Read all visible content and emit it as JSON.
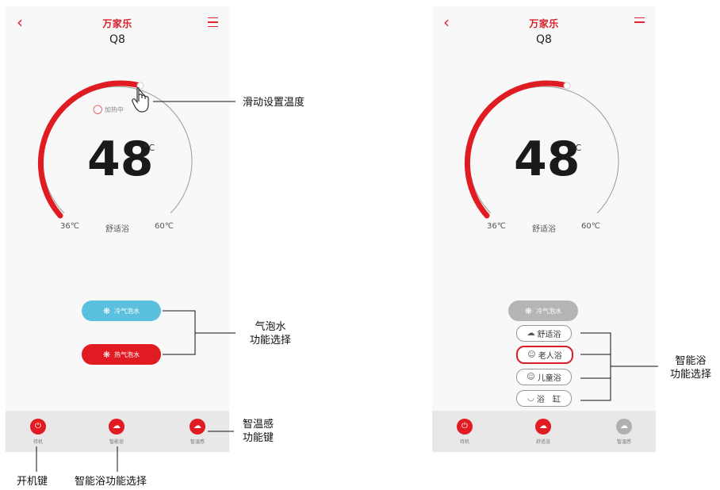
{
  "left_phone": {
    "back_icon": "back-chevron-icon",
    "menu_icon": "hamburger-menu-icon",
    "brand": "万家乐",
    "model": "Q8",
    "status_text": "加热中",
    "temperature": "48",
    "unit": "°C",
    "min_label": "36℃",
    "mode_label": "舒适浴",
    "max_label": "60℃",
    "bubble_cold_label": "冷气泡水",
    "bubble_hot_label": "热气泡水",
    "footer": [
      {
        "icon": "power-icon",
        "label": "待机"
      },
      {
        "icon": "cloud-icon",
        "label": "智能浴"
      },
      {
        "icon": "cloud-icon",
        "label": "智温感"
      }
    ]
  },
  "right_phone": {
    "brand": "万家乐",
    "model": "Q8",
    "temperature": "48",
    "unit": "°C",
    "min_label": "36℃",
    "mode_label": "舒适浴",
    "max_label": "60℃",
    "bubble_label": "冷气泡水",
    "modes": [
      {
        "icon": "cloud-icon",
        "label": "舒适浴",
        "active": false
      },
      {
        "icon": "smile-icon",
        "label": "老人浴",
        "active": true
      },
      {
        "icon": "smile-icon",
        "label": "儿童浴",
        "active": false
      },
      {
        "icon": "bathtub-icon",
        "label": "浴　缸",
        "active": false
      }
    ],
    "footer": [
      {
        "icon": "power-icon",
        "label": "待机"
      },
      {
        "icon": "cloud-icon",
        "label": "舒适浴"
      },
      {
        "icon": "cloud-icon",
        "label": "智温感"
      }
    ]
  },
  "annotations": {
    "slide_temp": "滑动设置温度",
    "bubble_line1": "气泡水",
    "bubble_line2": "功能选择",
    "smart_temp_line1": "智温感",
    "smart_temp_line2": "功能键",
    "power_key": "开机键",
    "smart_bath_select": "智能浴功能选择",
    "smart_bath_line1": "智能浴",
    "smart_bath_line2": "功能选择"
  },
  "colors": {
    "accent_red": "#e01b22",
    "bubble_blue": "#5bc0de",
    "inactive_grey": "#b0b0b0"
  }
}
